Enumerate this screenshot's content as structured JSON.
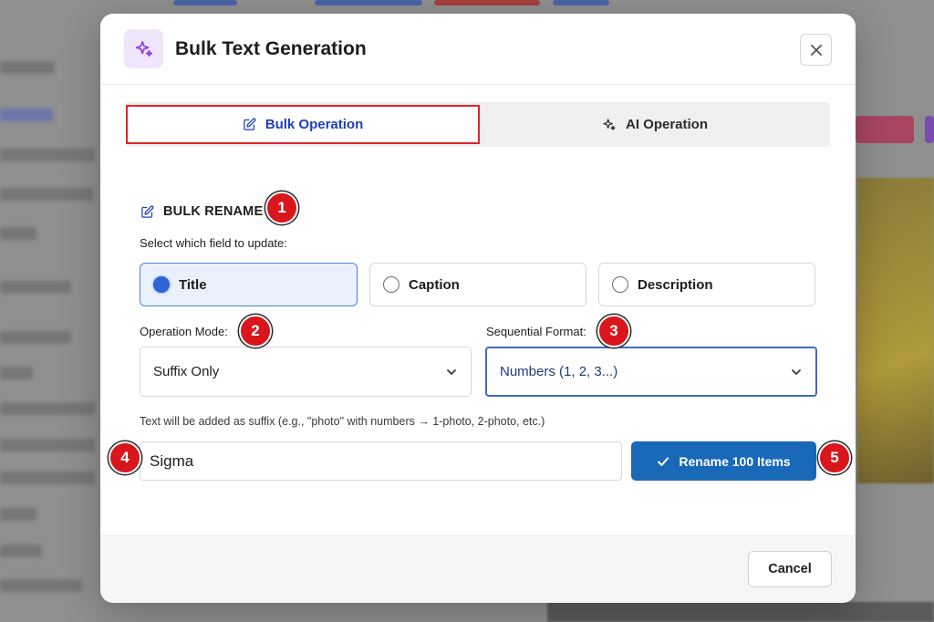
{
  "modal": {
    "title": "Bulk Text Generation",
    "header_icon": "sparkle-icon",
    "close_icon": "close-icon"
  },
  "tabs": [
    {
      "label": "Bulk Operation",
      "icon": "edit-icon",
      "active": true
    },
    {
      "label": "AI Operation",
      "icon": "sparkle-icon",
      "active": false
    }
  ],
  "section": {
    "title": "BULK RENAME",
    "icon": "edit-icon",
    "field_prompt": "Select which field to update:"
  },
  "fields": [
    {
      "label": "Title",
      "selected": true
    },
    {
      "label": "Caption",
      "selected": false
    },
    {
      "label": "Description",
      "selected": false
    }
  ],
  "operation_mode": {
    "label": "Operation Mode:",
    "value": "Suffix Only"
  },
  "sequential_format": {
    "label": "Sequential Format:",
    "value": "Numbers (1, 2, 3...)"
  },
  "hint": "Text will be added as suffix (e.g., \"photo\" with numbers → 1-photo, 2-photo, etc.)",
  "text_input": {
    "value": "Sigma"
  },
  "rename_button": {
    "label": "Rename 100 Items",
    "icon": "check-icon"
  },
  "cancel_button": {
    "label": "Cancel"
  },
  "badges": [
    "1",
    "2",
    "3",
    "4",
    "5"
  ],
  "colors": {
    "accent_blue": "#1a68b8",
    "tab_text_blue": "#1e3fb8",
    "highlight_red": "#e0242a",
    "badge_red": "#d9161c",
    "icon_bg_purple": "#efe6fb"
  }
}
